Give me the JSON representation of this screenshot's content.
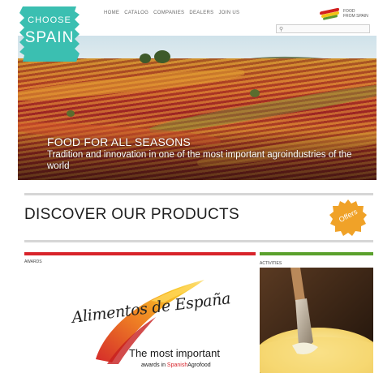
{
  "badge": {
    "line1": "CHOOSE",
    "line2": "SPAIN",
    "color": "#3bbfb1"
  },
  "nav": {
    "items": [
      {
        "label": "HOME"
      },
      {
        "label": "CATALOG"
      },
      {
        "label": "COMPANIES"
      },
      {
        "label": "DEALERS"
      },
      {
        "label": "JOIN US"
      }
    ]
  },
  "search": {
    "placeholder": "",
    "icon": "search-icon"
  },
  "brand": {
    "text_line1": "FOOD",
    "text_line2": "FROM SPAIN"
  },
  "hero": {
    "title": "FOOD FOR ALL SEASONS",
    "subtitle": "Tradition and innovation in one of the most important agroindustries of the world"
  },
  "discover": {
    "title": "DISCOVER OUR PRODUCTS"
  },
  "offers": {
    "label": "Offers",
    "color": "#f0a228"
  },
  "awards": {
    "section_label": "AWARDS",
    "logo_script": "Alimentos de España",
    "tagline1": "The most important",
    "tagline2_prefix": "awards in",
    "tagline2_highlight": "Spanish",
    "tagline2_suffix": "Agrofood",
    "accent": "#d8232a"
  },
  "activities": {
    "section_label": "ACTIVITIES",
    "accent": "#5aa02c"
  }
}
